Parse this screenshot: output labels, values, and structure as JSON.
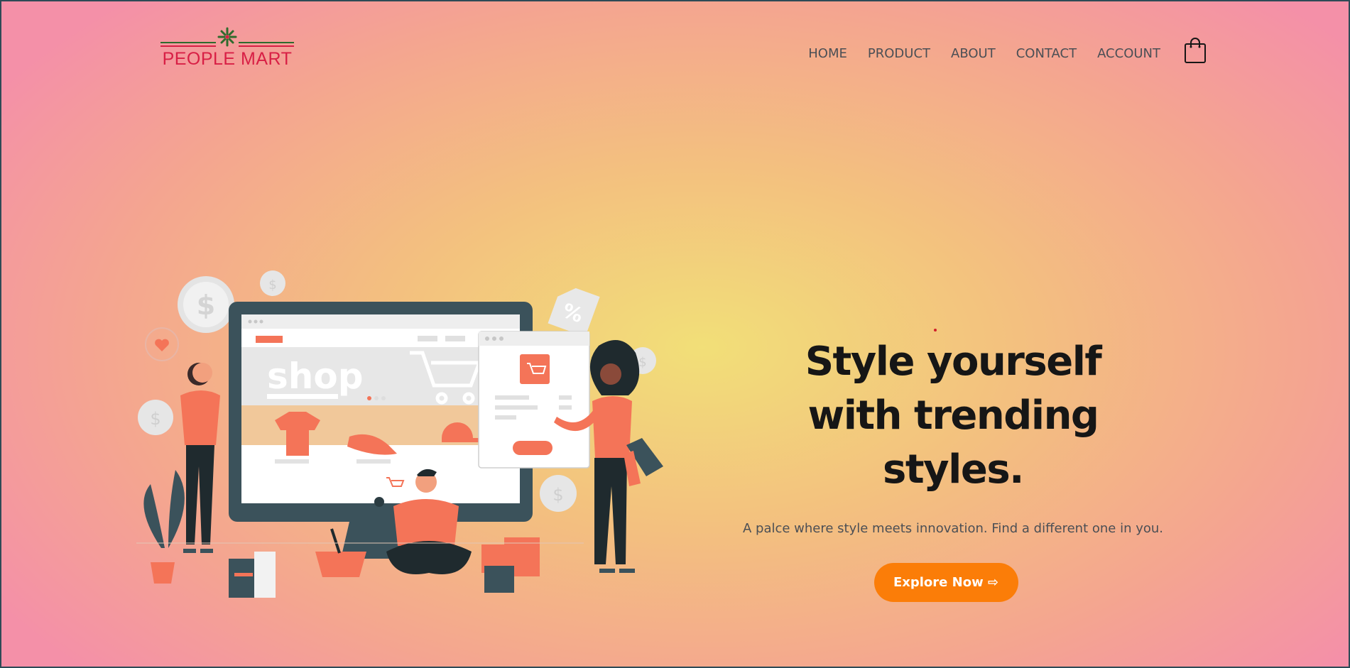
{
  "brand": {
    "name": "PEOPLE MART"
  },
  "nav": {
    "items": [
      {
        "label": "HOME"
      },
      {
        "label": "PRODUCT"
      },
      {
        "label": "ABOUT"
      },
      {
        "label": "CONTACT"
      },
      {
        "label": "ACCOUNT"
      }
    ],
    "cart_icon": "shopping-bag-icon"
  },
  "hero": {
    "title_line1": "Style yourself",
    "title_line2": "with trending styles.",
    "subtitle": "A palce where style meets innovation. Find a different one in you.",
    "cta_label": "Explore Now ⇨",
    "illustration": {
      "screen_text": "shop"
    }
  },
  "colors": {
    "accent": "#fb7d08",
    "brand_red": "#d81f45",
    "illustration_coral": "#f47458",
    "illustration_dark": "#3b525b"
  }
}
